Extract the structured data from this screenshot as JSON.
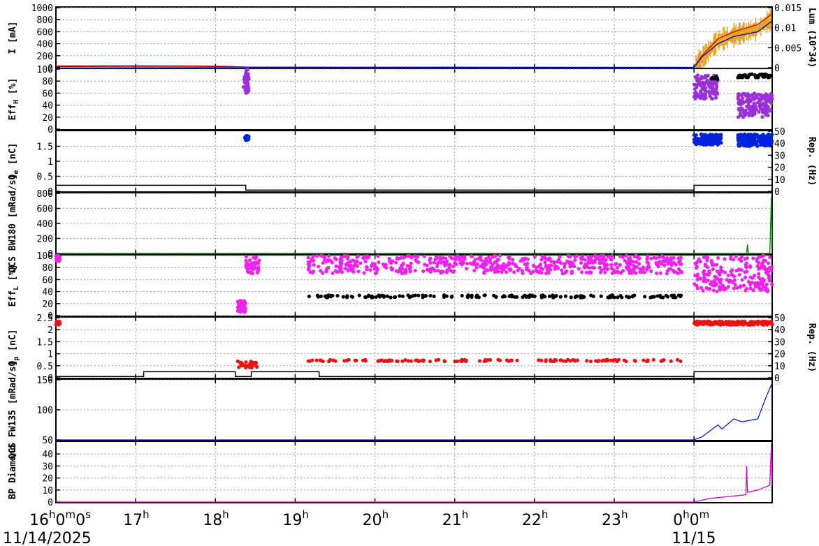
{
  "chart_data": {
    "type": "line",
    "x_axis": {
      "hour_labels": [
        {
          "main": "16",
          "sup": "h",
          "tail": "0",
          "tail_sup": "m",
          "tail2": "0",
          "tail2_sup": "s"
        },
        {
          "main": "17",
          "sup": "h"
        },
        {
          "main": "18",
          "sup": "h"
        },
        {
          "main": "19",
          "sup": "h"
        },
        {
          "main": "20",
          "sup": "h"
        },
        {
          "main": "21",
          "sup": "h"
        },
        {
          "main": "22",
          "sup": "h"
        },
        {
          "main": "23",
          "sup": "h"
        },
        {
          "main": "0",
          "sup": "h",
          "tail": "0",
          "tail_sup": "m"
        }
      ],
      "dates": [
        "11/14/2025",
        "11/15"
      ],
      "range_hours": [
        16.0,
        24.98
      ]
    },
    "panels": [
      {
        "id": "current",
        "ylabel": "I [mA]",
        "yticks": [
          "0",
          "200",
          "400",
          "600",
          "800",
          "1000"
        ],
        "ylim": [
          0,
          1000
        ],
        "right_label": "Lum (10^34)",
        "right_ticks": [
          "0",
          "0.005",
          "0.01",
          "0.015"
        ],
        "series": [
          {
            "color": "#e8a21a",
            "kind": "band",
            "points": [
              [
                16.0,
                5
              ],
              [
                18.4,
                5
              ],
              [
                24.0,
                5
              ],
              [
                24.1,
                150
              ],
              [
                24.3,
                450
              ],
              [
                24.5,
                540
              ],
              [
                24.8,
                650
              ],
              [
                24.98,
                820
              ]
            ]
          },
          {
            "color": "#cc0000",
            "kind": "line",
            "points": [
              [
                16.0,
                30
              ],
              [
                17.0,
                35
              ],
              [
                17.8,
                30
              ],
              [
                18.1,
                25
              ],
              [
                18.5,
                5
              ],
              [
                24.0,
                5
              ],
              [
                24.1,
                200
              ],
              [
                24.3,
                480
              ],
              [
                24.5,
                600
              ],
              [
                24.8,
                720
              ],
              [
                24.98,
                900
              ]
            ]
          },
          {
            "color": "#0000cc",
            "kind": "line",
            "points": [
              [
                16.0,
                15
              ],
              [
                18.4,
                10
              ],
              [
                24.0,
                5
              ],
              [
                24.1,
                180
              ],
              [
                24.3,
                400
              ],
              [
                24.5,
                520
              ],
              [
                24.8,
                600
              ],
              [
                24.98,
                780
              ]
            ]
          }
        ]
      },
      {
        "id": "effh",
        "ylabel": "Eff_H [%]",
        "yticks": [
          "0",
          "20",
          "40",
          "60",
          "80",
          "100"
        ],
        "ylim": [
          0,
          100
        ],
        "clusters": [
          {
            "color": "#9b30d8",
            "x": [
              18.35,
              18.42
            ],
            "y": [
              60,
              100
            ],
            "n": 40
          },
          {
            "color": "#9b30d8",
            "x": [
              24.0,
              24.3
            ],
            "y": [
              50,
              90
            ],
            "n": 120
          },
          {
            "color": "#9b30d8",
            "x": [
              24.55,
              24.98
            ],
            "y": [
              20,
              60
            ],
            "n": 160
          },
          {
            "color": "#000000",
            "x": [
              24.2,
              24.33
            ],
            "y": [
              83,
              88
            ],
            "n": 10
          },
          {
            "color": "#000000",
            "x": [
              24.55,
              24.98
            ],
            "y": [
              86,
              92
            ],
            "n": 40
          }
        ]
      },
      {
        "id": "qe",
        "ylabel": "Q_e [nC]",
        "yticks": [
          "0",
          "0.5",
          "1",
          "1.5"
        ],
        "ylim": [
          0,
          2
        ],
        "right_label": "Rep. (Hz)",
        "right_ticks": [
          "0",
          "10",
          "20",
          "30",
          "40",
          "50"
        ],
        "clusters": [
          {
            "color": "#0022dd",
            "x": [
              18.37,
              18.42
            ],
            "y": [
              1.7,
              1.85
            ],
            "n": 30
          },
          {
            "color": "#0022dd",
            "x": [
              24.0,
              24.35
            ],
            "y": [
              1.55,
              1.9
            ],
            "n": 160
          },
          {
            "color": "#0022dd",
            "x": [
              24.55,
              24.98
            ],
            "y": [
              1.5,
              1.9
            ],
            "n": 200
          }
        ],
        "rep_steps": [
          [
            16.0,
            5
          ],
          [
            18.38,
            5
          ],
          [
            18.38,
            1
          ],
          [
            24.0,
            1
          ],
          [
            24.0,
            5
          ],
          [
            24.98,
            5
          ]
        ]
      },
      {
        "id": "qcs_bw",
        "ylabel": "QCS BW180 [mRad/s]",
        "yticks": [
          "0",
          "200",
          "400",
          "600",
          "800"
        ],
        "ylim": [
          0,
          800
        ],
        "series": [
          {
            "color": "#007700",
            "kind": "line",
            "points": [
              [
                16.0,
                0
              ],
              [
                24.66,
                0
              ],
              [
                24.67,
                120
              ],
              [
                24.68,
                0
              ],
              [
                24.95,
                0
              ],
              [
                24.97,
                750
              ],
              [
                24.98,
                0
              ]
            ]
          }
        ]
      },
      {
        "id": "effl",
        "ylabel": "Eff_L [%]",
        "yticks": [
          "0",
          "20",
          "40",
          "60",
          "80",
          "100"
        ],
        "ylim": [
          0,
          100
        ],
        "clusters": [
          {
            "color": "#ee22ee",
            "x": [
              16.0,
              16.05
            ],
            "y": [
              90,
              100
            ],
            "n": 20
          },
          {
            "color": "#ee22ee",
            "x": [
              18.28,
              18.38
            ],
            "y": [
              5,
              25
            ],
            "n": 40
          },
          {
            "color": "#ee22ee",
            "x": [
              18.38,
              18.55
            ],
            "y": [
              70,
              100
            ],
            "n": 40
          },
          {
            "color": "#ee22ee",
            "x": [
              19.15,
              23.85
            ],
            "y": [
              70,
              100
            ],
            "n": 600
          },
          {
            "color": "#ee22ee",
            "x": [
              24.0,
              24.98
            ],
            "y": [
              40,
              100
            ],
            "n": 200
          },
          {
            "color": "#000000",
            "x": [
              19.15,
              23.85
            ],
            "y": [
              30,
              34
            ],
            "n": 160
          }
        ]
      },
      {
        "id": "qp",
        "ylabel": "Q_p [nC]",
        "yticks": [
          "0",
          "0.5",
          "1",
          "1.5",
          "2",
          "2.5"
        ],
        "ylim": [
          0,
          2.5
        ],
        "right_label": "Rep. (Hz)",
        "right_ticks": [
          "0",
          "10",
          "20",
          "30",
          "40",
          "50"
        ],
        "clusters": [
          {
            "color": "#ee1111",
            "x": [
              16.0,
              16.05
            ],
            "y": [
              2.2,
              2.35
            ],
            "n": 15
          },
          {
            "color": "#ee1111",
            "x": [
              18.28,
              18.55
            ],
            "y": [
              0.4,
              0.7
            ],
            "n": 30
          },
          {
            "color": "#ee1111",
            "x": [
              19.15,
              23.85
            ],
            "y": [
              0.68,
              0.75
            ],
            "n": 130
          },
          {
            "color": "#ee1111",
            "x": [
              24.0,
              24.98
            ],
            "y": [
              2.2,
              2.35
            ],
            "n": 200
          }
        ],
        "rep_steps": [
          [
            16.0,
            1
          ],
          [
            17.1,
            1
          ],
          [
            17.1,
            5
          ],
          [
            18.25,
            5
          ],
          [
            18.25,
            1
          ],
          [
            18.45,
            1
          ],
          [
            18.45,
            5
          ],
          [
            19.3,
            5
          ],
          [
            19.3,
            1
          ],
          [
            24.0,
            1
          ],
          [
            24.0,
            5
          ],
          [
            24.98,
            5
          ]
        ]
      },
      {
        "id": "qcs_fw",
        "ylabel": "QCS FW135 [mRad/s]",
        "yticks": [
          "50",
          "100",
          "150"
        ],
        "ylim": [
          50,
          150
        ],
        "series": [
          {
            "color": "#0022cc",
            "kind": "line",
            "points": [
              [
                16.0,
                50
              ],
              [
                24.0,
                50
              ],
              [
                24.1,
                55
              ],
              [
                24.3,
                75
              ],
              [
                24.35,
                68
              ],
              [
                24.5,
                85
              ],
              [
                24.6,
                80
              ],
              [
                24.8,
                85
              ],
              [
                24.9,
                120
              ],
              [
                24.98,
                145
              ]
            ]
          }
        ]
      },
      {
        "id": "bp_diamond",
        "ylabel": "BP Diamond",
        "yticks": [
          "0",
          "10",
          "20",
          "30",
          "40"
        ],
        "ylim": [
          0,
          50
        ],
        "series": [
          {
            "color": "#cc00cc",
            "kind": "line",
            "points": [
              [
                16.0,
                0
              ],
              [
                24.0,
                0
              ],
              [
                24.2,
                3
              ],
              [
                24.5,
                5
              ],
              [
                24.65,
                6
              ],
              [
                24.66,
                30
              ],
              [
                24.67,
                8
              ],
              [
                24.8,
                10
              ],
              [
                24.95,
                14
              ],
              [
                24.97,
                48
              ],
              [
                24.98,
                14
              ]
            ]
          }
        ]
      }
    ]
  }
}
